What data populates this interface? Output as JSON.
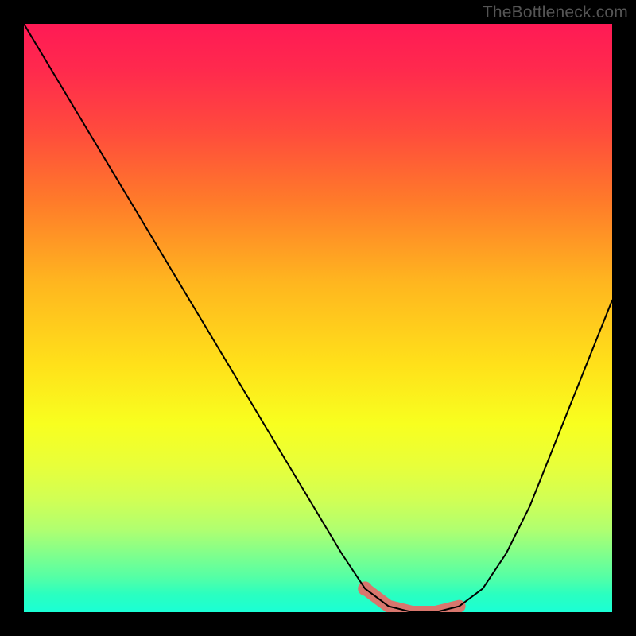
{
  "watermark": "TheBottleneck.com",
  "colors": {
    "background": "#000000",
    "curve": "#000000",
    "highlight": "#d8766d"
  },
  "chart_data": {
    "type": "line",
    "title": "",
    "xlabel": "",
    "ylabel": "",
    "xlim": [
      0,
      100
    ],
    "ylim": [
      0,
      100
    ],
    "grid": false,
    "legend": false,
    "series": [
      {
        "name": "bottleneck-curve",
        "x": [
          0,
          6,
          12,
          18,
          24,
          30,
          36,
          42,
          48,
          54,
          58,
          62,
          66,
          70,
          74,
          78,
          82,
          86,
          90,
          94,
          98,
          100
        ],
        "y": [
          100,
          90,
          80,
          70,
          60,
          50,
          40,
          30,
          20,
          10,
          4,
          1,
          0,
          0,
          1,
          4,
          10,
          18,
          28,
          38,
          48,
          53
        ]
      }
    ],
    "annotations": [
      {
        "name": "optimal-range-highlight",
        "x_start": 58,
        "x_end": 76,
        "color": "#d8766d"
      },
      {
        "name": "optimal-point-dot",
        "x": 58,
        "y": 4,
        "color": "#d8766d"
      }
    ],
    "background_gradient": {
      "direction": "vertical",
      "stops": [
        {
          "pos": 0.0,
          "color": "#ff1a55"
        },
        {
          "pos": 0.3,
          "color": "#ff7a2a"
        },
        {
          "pos": 0.6,
          "color": "#ffe11a"
        },
        {
          "pos": 0.8,
          "color": "#d0ff55"
        },
        {
          "pos": 1.0,
          "color": "#1affd5"
        }
      ]
    }
  }
}
